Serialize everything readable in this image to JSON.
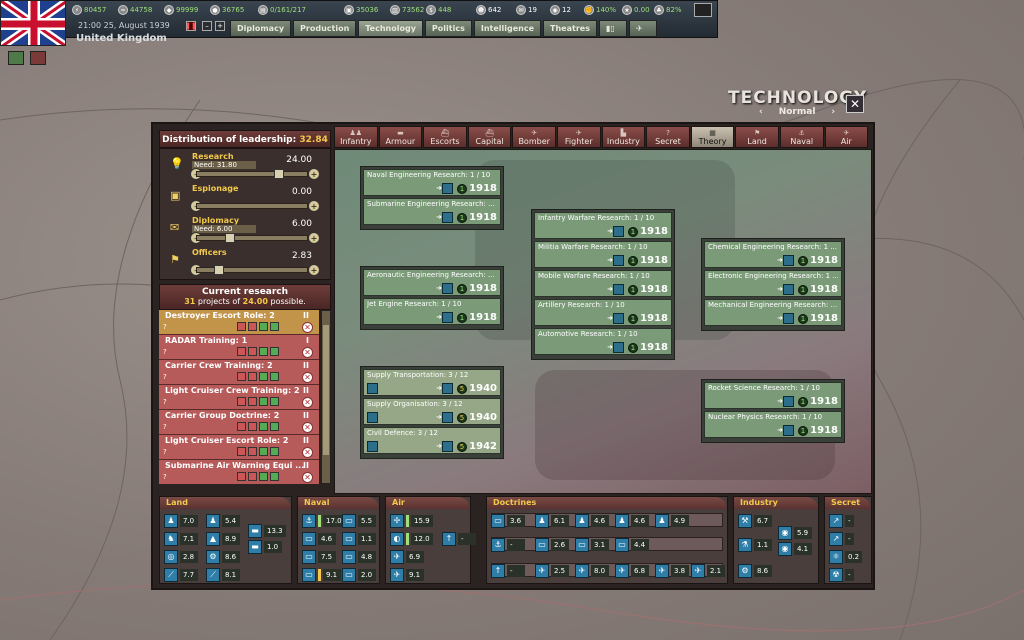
{
  "topbar": {
    "resources": [
      {
        "icon": "energy-icon",
        "value": "80457"
      },
      {
        "icon": "metal-icon",
        "value": "44758"
      },
      {
        "icon": "rare-materials-icon",
        "value": "99999"
      },
      {
        "icon": "oil-icon",
        "value": "36765"
      },
      {
        "icon": "supplies-icon",
        "value": "0/161/217"
      },
      {
        "icon": "fuel-icon",
        "value": "35036"
      },
      {
        "icon": "money-icon",
        "value": "73562"
      },
      {
        "icon": "dollar-icon",
        "value": "448"
      },
      {
        "icon": "manpower-icon",
        "value": "642"
      },
      {
        "icon": "diplomacy-icon",
        "value": "19"
      },
      {
        "icon": "spy-icon",
        "value": "12"
      },
      {
        "icon": "dissent-icon",
        "value": "140%"
      },
      {
        "icon": "officers-icon",
        "value": "0.00"
      },
      {
        "icon": "national-unity-icon",
        "value": "82%"
      }
    ],
    "date": "21:00 25, August 1939",
    "country": "United Kingdom",
    "menu_tabs": [
      "Diplomacy",
      "Production",
      "Technology",
      "Politics",
      "Intelligence",
      "Theatres"
    ]
  },
  "header": {
    "title": "TECHNOLOGY",
    "mode": "Normal"
  },
  "distribution": {
    "title": "Distribution of leadership:",
    "total": "32.84",
    "rows": [
      {
        "name": "Research",
        "need": "Need: 31.80",
        "value": "24.00",
        "level": 0.7
      },
      {
        "name": "Espionage",
        "need": "",
        "value": "0.00",
        "level": 0.0
      },
      {
        "name": "Diplomacy",
        "need": "Need: 6.00",
        "value": "6.00",
        "level": 0.25
      },
      {
        "name": "Officers",
        "need": "",
        "value": "2.83",
        "level": 0.15
      }
    ]
  },
  "current_research": {
    "title": "Current research",
    "count": "31",
    "mid": "projects of",
    "possible": "24.00",
    "suffix": "possible.",
    "items": [
      {
        "name": "Destroyer Escort Role: 2",
        "q": "?",
        "priority": "II"
      },
      {
        "name": "RADAR Training: 1",
        "q": "?",
        "priority": "I"
      },
      {
        "name": "Carrier Crew Training: 2",
        "q": "?",
        "priority": "II"
      },
      {
        "name": "Light Cruiser Crew Training: 2",
        "q": "?",
        "priority": "II"
      },
      {
        "name": "Carrier Group Doctrine: 2",
        "q": "?",
        "priority": "II"
      },
      {
        "name": "Light Cruiser Escort Role: 2",
        "q": "?",
        "priority": "II"
      },
      {
        "name": "Submarine Air Warning Equi ...",
        "q": "?",
        "priority": "II"
      }
    ]
  },
  "tabs": [
    "Infantry",
    "Armour",
    "Escorts",
    "Capital",
    "Bomber",
    "Fighter",
    "Industry",
    "Secret",
    "Theory",
    "Land",
    "Naval",
    "Air"
  ],
  "active_tab": "Theory",
  "tech_groups": [
    {
      "cards": [
        {
          "name": "Naval Engineering Research: 1 / 10",
          "level": "1",
          "year": "1918"
        },
        {
          "name": "Submarine Engineering Research: ...",
          "level": "1",
          "year": "1918"
        }
      ]
    },
    {
      "cards": [
        {
          "name": "Aeronautic Engineering Research: ...",
          "level": "1",
          "year": "1918"
        },
        {
          "name": "Jet Engine Research: 1 / 10",
          "level": "1",
          "year": "1918"
        }
      ]
    },
    {
      "cards": [
        {
          "name": "Supply Transportation: 3 / 12",
          "level": "5",
          "year": "1940"
        },
        {
          "name": "Supply Organisation: 3 / 12",
          "level": "5",
          "year": "1940"
        },
        {
          "name": "Civil Defence: 3 / 12",
          "level": "5",
          "year": "1942"
        }
      ]
    },
    {
      "cards": [
        {
          "name": "Infantry Warfare Research: 1 / 10",
          "level": "1",
          "year": "1918"
        },
        {
          "name": "Militia Warfare Research: 1 / 10",
          "level": "1",
          "year": "1918"
        },
        {
          "name": "Mobile Warfare Research: 1 / 10",
          "level": "1",
          "year": "1918"
        },
        {
          "name": "Artillery Research: 1 / 10",
          "level": "1",
          "year": "1918"
        },
        {
          "name": "Automotive Research: 1 / 10",
          "level": "1",
          "year": "1918"
        }
      ]
    },
    {
      "cards": [
        {
          "name": "Chemical Engineering Research: 1 ...",
          "level": "1",
          "year": "1918"
        },
        {
          "name": "Electronic Engineering Research: 1 ...",
          "level": "1",
          "year": "1918"
        },
        {
          "name": "Mechanical Engineering Research: ...",
          "level": "1",
          "year": "1918"
        }
      ]
    },
    {
      "cards": [
        {
          "name": "Rocket Science Research: 1 / 10",
          "level": "1",
          "year": "1918"
        },
        {
          "name": "Nuclear Physics Research: 1 / 10",
          "level": "1",
          "year": "1918"
        }
      ]
    }
  ],
  "bottom": {
    "land": {
      "title": "Land",
      "values": [
        "7.0",
        "5.4",
        "7.1",
        "8.9",
        "13.3",
        "1.0",
        "2.8",
        "8.6",
        "7.7",
        "8.1"
      ]
    },
    "naval": {
      "title": "Naval",
      "values": [
        "17.0",
        "5.5",
        "4.6",
        "1.1",
        "7.5",
        "4.8",
        "9.1",
        "2.0"
      ]
    },
    "air": {
      "title": "Air",
      "values": [
        "15.9",
        "12.0",
        "6.9",
        "9.1",
        "-"
      ]
    },
    "doctrines": {
      "title": "Doctrines",
      "values": [
        "3.6",
        "6.1",
        "4.6",
        "4.6",
        "4.9",
        "-",
        "2.6",
        "3.1",
        "4.4",
        "-",
        "2.5",
        "8.0",
        "6.8",
        "3.8",
        "2.1"
      ]
    },
    "industry": {
      "title": "Industry",
      "values": [
        "6.7",
        "1.1",
        "5.9",
        "4.1",
        "8.6"
      ]
    },
    "secret": {
      "title": "Secret",
      "values": [
        "-",
        "-",
        "0.2",
        "-"
      ]
    }
  }
}
